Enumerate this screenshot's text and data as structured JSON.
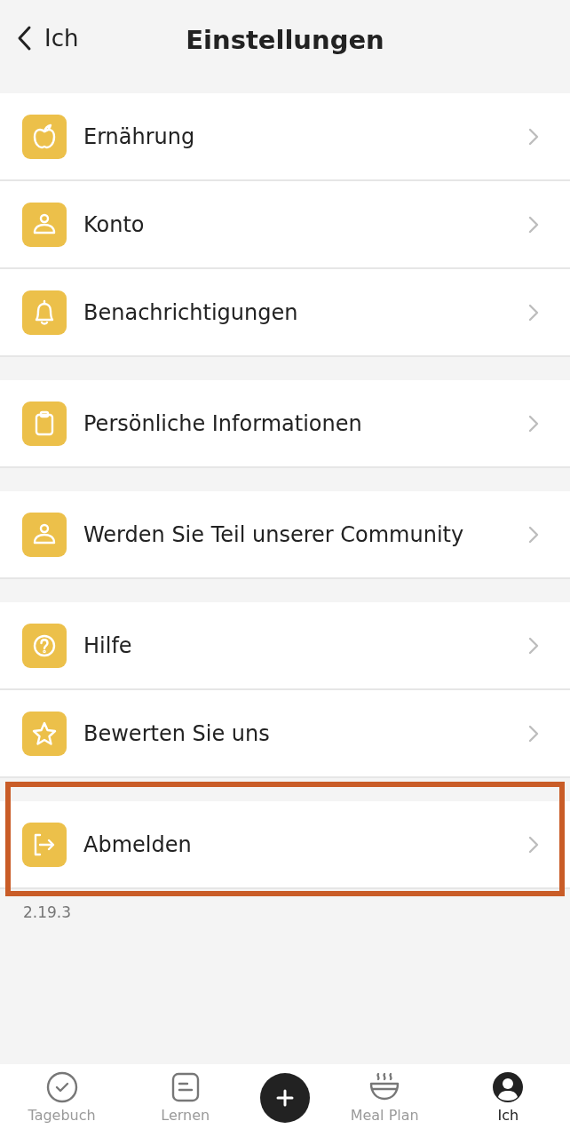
{
  "header": {
    "back_label": "Ich",
    "title": "Einstellungen"
  },
  "groups": [
    {
      "highlighted": false,
      "items": [
        {
          "kind": "apple",
          "label": "Ernährung"
        },
        {
          "kind": "person",
          "label": "Konto"
        },
        {
          "kind": "bell",
          "label": "Benachrichtigungen"
        }
      ]
    },
    {
      "highlighted": false,
      "items": [
        {
          "kind": "clipboard",
          "label": "Persönliche Informationen"
        }
      ]
    },
    {
      "highlighted": false,
      "items": [
        {
          "kind": "person",
          "label": "Werden Sie Teil unserer Community"
        }
      ]
    },
    {
      "highlighted": false,
      "items": [
        {
          "kind": "question",
          "label": "Hilfe"
        },
        {
          "kind": "star",
          "label": "Bewerten Sie uns"
        }
      ]
    },
    {
      "highlighted": true,
      "items": [
        {
          "kind": "logout",
          "label": "Abmelden"
        }
      ]
    }
  ],
  "version": "2.19.3",
  "tab_bar": [
    {
      "kind": "check",
      "label": "Tagebuch",
      "selected": false
    },
    {
      "kind": "note",
      "label": "Lernen",
      "selected": false
    },
    {
      "kind": "plus",
      "selected": false
    },
    {
      "kind": "bowl",
      "label": "Meal Plan",
      "selected": false
    },
    {
      "kind": "person",
      "label": "Ich",
      "selected": true
    }
  ]
}
